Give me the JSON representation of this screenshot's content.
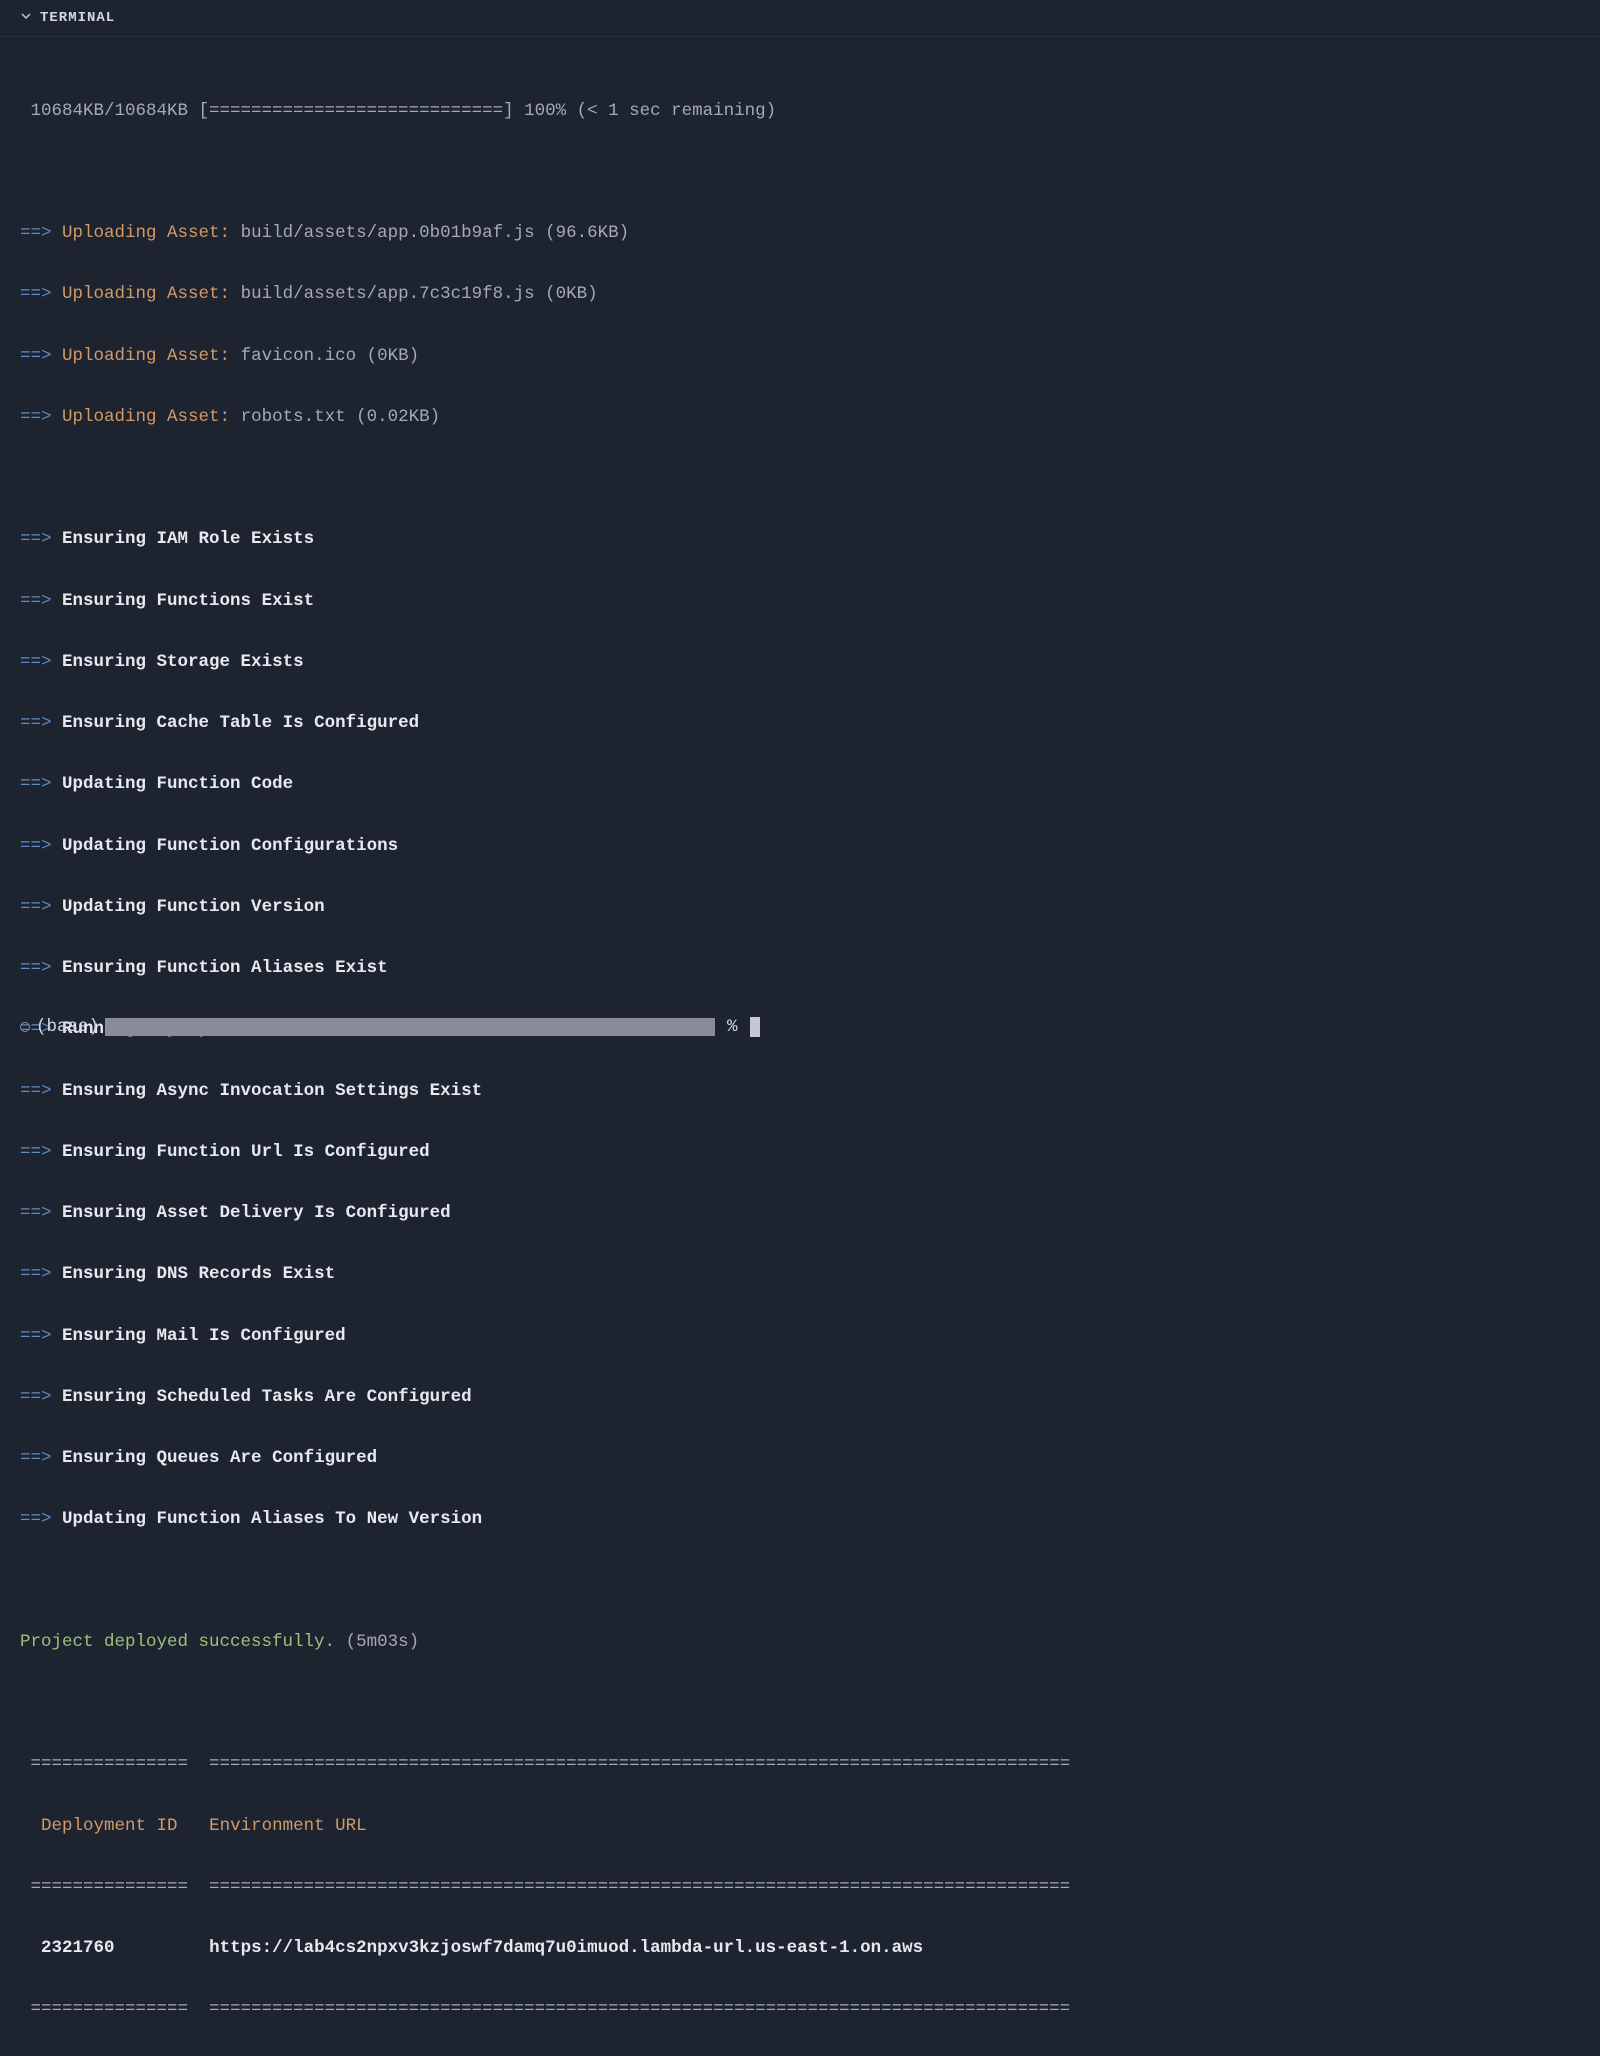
{
  "header": {
    "title": "TERMINAL"
  },
  "progress": {
    "text": " 10684KB/10684KB [============================] 100% (< 1 sec remaining)"
  },
  "uploads": [
    {
      "arrow": "==>",
      "label": "Uploading Asset:",
      "path": "build/assets/app.0b01b9af.js (96.6KB)"
    },
    {
      "arrow": "==>",
      "label": "Uploading Asset:",
      "path": "build/assets/app.7c3c19f8.js (0KB)"
    },
    {
      "arrow": "==>",
      "label": "Uploading Asset:",
      "path": "favicon.ico (0KB)"
    },
    {
      "arrow": "==>",
      "label": "Uploading Asset:",
      "path": "robots.txt (0.02KB)"
    }
  ],
  "steps": [
    {
      "arrow": "==>",
      "text": "Ensuring IAM Role Exists"
    },
    {
      "arrow": "==>",
      "text": "Ensuring Functions Exist"
    },
    {
      "arrow": "==>",
      "text": "Ensuring Storage Exists"
    },
    {
      "arrow": "==>",
      "text": "Ensuring Cache Table Is Configured"
    },
    {
      "arrow": "==>",
      "text": "Updating Function Code"
    },
    {
      "arrow": "==>",
      "text": "Updating Function Configurations"
    },
    {
      "arrow": "==>",
      "text": "Updating Function Version"
    },
    {
      "arrow": "==>",
      "text": "Ensuring Function Aliases Exist"
    },
    {
      "arrow": "==>",
      "text": "Running Deployment Hooks"
    },
    {
      "arrow": "==>",
      "text": "Ensuring Async Invocation Settings Exist"
    },
    {
      "arrow": "==>",
      "text": "Ensuring Function Url Is Configured"
    },
    {
      "arrow": "==>",
      "text": "Ensuring Asset Delivery Is Configured"
    },
    {
      "arrow": "==>",
      "text": "Ensuring DNS Records Exist"
    },
    {
      "arrow": "==>",
      "text": "Ensuring Mail Is Configured"
    },
    {
      "arrow": "==>",
      "text": "Ensuring Scheduled Tasks Are Configured"
    },
    {
      "arrow": "==>",
      "text": "Ensuring Queues Are Configured"
    },
    {
      "arrow": "==>",
      "text": "Updating Function Aliases To New Version"
    }
  ],
  "success": {
    "message": "Project deployed successfully.",
    "duration": "(5m03s)"
  },
  "table": {
    "col1_sep": " =============== ",
    "col2_sep": "==================================================================================",
    "col1_header": " Deployment ID  ",
    "col2_header": "Environment URL",
    "deployment_id": " 2321760        ",
    "environment_url": "https://lab4cs2npxv3kzjoswf7damq7u0imuod.lambda-url.us-east-1.on.aws"
  },
  "prompt": {
    "env": "(base)",
    "percent": "%"
  }
}
